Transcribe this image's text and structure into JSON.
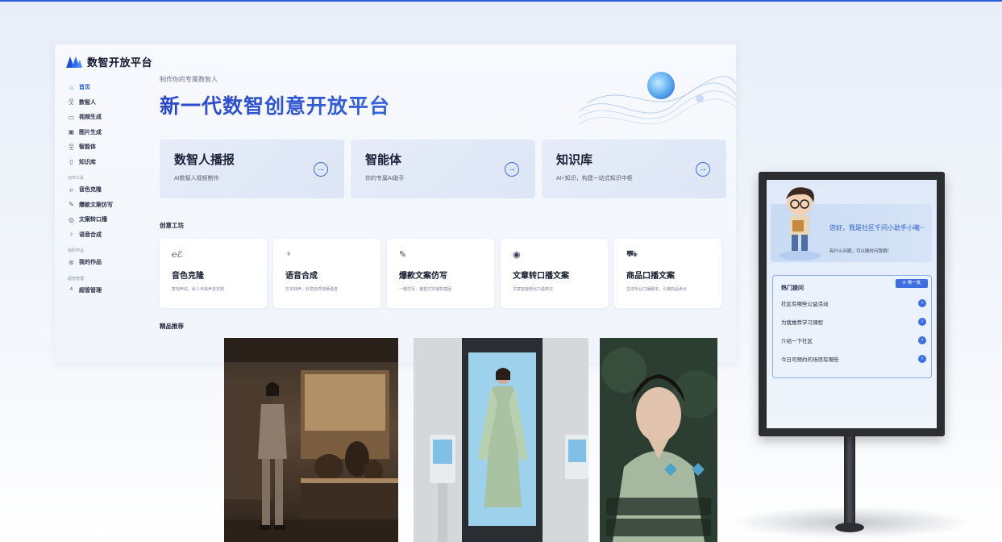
{
  "app": {
    "logo_text": "数智开放平台",
    "brand_color": "#2b5fd9"
  },
  "sidebar": {
    "items_top": [
      {
        "label": "首页",
        "icon": "home-icon",
        "active": true
      },
      {
        "label": "数智人",
        "icon": "person-icon"
      },
      {
        "label": "视频生成",
        "icon": "video-icon"
      },
      {
        "label": "图片生成",
        "icon": "image-icon"
      },
      {
        "label": "智能体",
        "icon": "agent-icon"
      },
      {
        "label": "知识库",
        "icon": "book-icon"
      }
    ],
    "group_tools": "创作工具",
    "items_tools": [
      {
        "label": "音色克隆",
        "icon": "voice-clone-icon"
      },
      {
        "label": "爆款文案仿写",
        "icon": "pen-icon"
      },
      {
        "label": "文案转口播",
        "icon": "convert-icon"
      },
      {
        "label": "语音合成",
        "icon": "mic-icon"
      }
    ],
    "group_works": "我的作品",
    "items_works": [
      {
        "label": "我的作品",
        "icon": "works-icon"
      }
    ],
    "group_admin": "超管管理",
    "items_admin": [
      {
        "label": "超管管理",
        "icon": "admin-icon"
      }
    ]
  },
  "hero": {
    "subtitle": "制作你的专属数智人",
    "title": "新一代数智创意开放平台"
  },
  "features": [
    {
      "title": "数智人播报",
      "desc": "AI数智人视频制作",
      "icon": "arrow-right-circle-icon"
    },
    {
      "title": "智能体",
      "desc": "你的专属AI助手",
      "icon": "arrow-right-circle-icon"
    },
    {
      "title": "知识库",
      "desc": "AI+知识，构建一站式知识中枢",
      "icon": "arrow-right-circle-icon"
    }
  ],
  "workshop": {
    "title": "创意工坊",
    "tools": [
      {
        "icon": "voice-clone-icon",
        "glyph": "℮ℰ",
        "title": "音色克隆",
        "desc": "复刻声纹，私人专属声音定制"
      },
      {
        "icon": "mic-icon",
        "glyph": "♀",
        "title": "语音合成",
        "desc": "文本转声，秒变自然流畅语音"
      },
      {
        "icon": "pen-icon",
        "glyph": "✎",
        "title": "爆款文案仿写",
        "desc": "一键仿写，重塑文字爆款基因"
      },
      {
        "icon": "convert-icon",
        "glyph": "◉",
        "title": "文章转口播文案",
        "desc": "文章智能转化口语表达"
      },
      {
        "icon": "cart-icon",
        "glyph": "⛟",
        "title": "商品口播文案",
        "desc": "生成专业口播脚本，引爆商品卖点"
      }
    ]
  },
  "featured": {
    "title": "精品推荐"
  },
  "kiosk": {
    "greeting": "您好，我是社区千问小助手小曦~",
    "greeting_sub": "有什么问题，可以随时问我哦！",
    "faq_title": "热门提问",
    "refresh_label": "换一批",
    "questions": [
      "社区有哪些公益活动",
      "为我推荐学习课程",
      "介绍一下社区",
      "今日可预约的场馆有哪些"
    ]
  }
}
